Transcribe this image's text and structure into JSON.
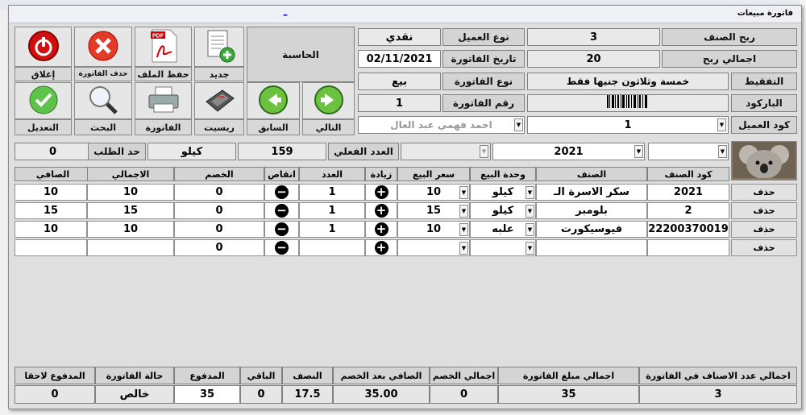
{
  "window": {
    "title": "فاتورة مبيعات",
    "close_glyph": "–"
  },
  "toolbar": {
    "calc_label": "الحاسبة",
    "close_label": "إغلاق",
    "delete_label": "حذف الفاتورة",
    "save_file_label": "حفظ الملف",
    "new_label": "جديد",
    "edit_label": "التعديل",
    "search_label": "البحث",
    "invoice_label": "الفاتورة",
    "receipt_label": "ريسيت",
    "prev_label": "السابق",
    "next_label": "التالي"
  },
  "customer": {
    "customer_type_label": "نوع العميل",
    "customer_type_value": "نقدي",
    "invoice_date_label": "تاريخ الفاتورة",
    "invoice_date_value": "02/11/2021",
    "invoice_type_label": "نوع الفاتورة",
    "invoice_type_value": "بيع",
    "invoice_number_label": "رقم الفاتورة",
    "invoice_number_value": "1",
    "customer_name_value": "احمد فهمي عبد العال"
  },
  "item": {
    "profit_label": "ربح الصنف",
    "profit_value": "3",
    "total_profit_label": "اجمالي ربح",
    "total_profit_value": "20",
    "spelled_label": "التفقيط",
    "spelled_value": "خمسة وثلاثون جنيها فقط",
    "barcode_label": "الباركود",
    "customer_code_label": "كود العميل",
    "customer_code_value": "1"
  },
  "filter": {
    "year_value": "2021",
    "actual_count_label": "العدد الفعلي",
    "actual_count_value": "159",
    "unit_value": "كيلو",
    "order_limit_label": "حد الطلب",
    "order_limit_value": "0"
  },
  "table": {
    "headers": {
      "code": "كود الصنف",
      "item": "الصنف",
      "unit": "وحدة البيع",
      "price": "سعر البيع",
      "inc": "زيادة",
      "count": "العدد",
      "dec": "انقاص",
      "discount": "الخصم",
      "total": "الاجمالي",
      "net": "الصافي"
    },
    "delete_label": "حذف",
    "rows": [
      {
        "code": "2021",
        "item": "سكر الاسرة الـ",
        "unit": "كيلو",
        "price": "10",
        "count": "1",
        "discount": "0",
        "total": "10",
        "net": "10"
      },
      {
        "code": "2",
        "item": "بلومبر",
        "unit": "كيلو",
        "price": "15",
        "count": "1",
        "discount": "0",
        "total": "15",
        "net": "15"
      },
      {
        "code": "22200370019",
        "item": "فيوسيكورت",
        "unit": "علبه",
        "price": "10",
        "count": "1",
        "discount": "0",
        "total": "10",
        "net": "10"
      },
      {
        "code": "",
        "item": "",
        "unit": "",
        "price": "",
        "count": "",
        "discount": "0",
        "total": "",
        "net": ""
      }
    ]
  },
  "summary": {
    "items_count_label": "اجمالي عدد الاصناف في الفاتورة",
    "items_count_value": "3",
    "invoice_total_label": "اجمالي مبلغ الفاتورة",
    "invoice_total_value": "35",
    "discount_total_label": "اجمالي الخصم",
    "discount_total_value": "0",
    "net_after_label": "الصافي بعد الخصم",
    "net_after_value": "35.00",
    "half_label": "النصف",
    "half_value": "17.5",
    "remaining_label": "الباقي",
    "remaining_value": "0",
    "paid_label": "المدفوع",
    "paid_value": "35",
    "status_label": "حالة الفاتورة",
    "status_value": "خالص",
    "deferred_label": "المدفوع لاحقا",
    "deferred_value": "0"
  }
}
